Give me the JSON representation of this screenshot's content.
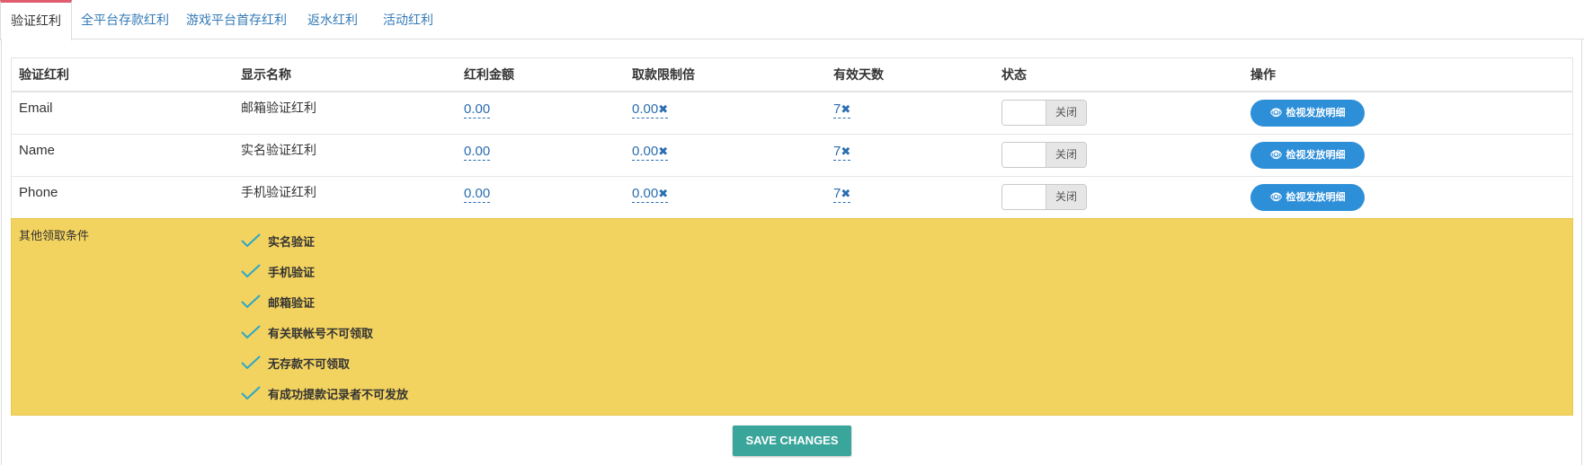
{
  "tabs": [
    {
      "label": "验证红利",
      "active": true
    },
    {
      "label": "全平台存款红利"
    },
    {
      "label": "游戏平台首存红利"
    },
    {
      "label": "返水红利"
    },
    {
      "label": "活动红利"
    }
  ],
  "table": {
    "headers": [
      "验证红利",
      "显示名称",
      "红利金额",
      "取款限制倍",
      "有效天数",
      "状态",
      "操作"
    ],
    "rows": [
      {
        "type": "Email",
        "display_name": "邮箱验证红利",
        "amount": "0.00",
        "withdraw_multiplier": "0.00",
        "valid_days": "7",
        "status": "关闭",
        "action": "检视发放明细"
      },
      {
        "type": "Name",
        "display_name": "实名验证红利",
        "amount": "0.00",
        "withdraw_multiplier": "0.00",
        "valid_days": "7",
        "status": "关闭",
        "action": "检视发放明细"
      },
      {
        "type": "Phone",
        "display_name": "手机验证红利",
        "amount": "0.00",
        "withdraw_multiplier": "0.00",
        "valid_days": "7",
        "status": "关闭",
        "action": "检视发放明细"
      }
    ]
  },
  "extra": {
    "label": "其他领取条件",
    "conditions": [
      "实名验证",
      "手机验证",
      "邮箱验证",
      "有关联帐号不可领取",
      "无存款不可领取",
      "有成功提款记录者不可发放"
    ]
  },
  "save_label": "SAVE CHANGES",
  "icons": {
    "remove": "x-icon",
    "view": "eye-icon",
    "check": "check-icon"
  },
  "colors": {
    "accent_tab": "#e05d6f",
    "link": "#2a6db0",
    "button": "#2e8fd9",
    "highlight": "#f3d35f",
    "save": "#3aa59a",
    "check": "#2aa7c9"
  }
}
